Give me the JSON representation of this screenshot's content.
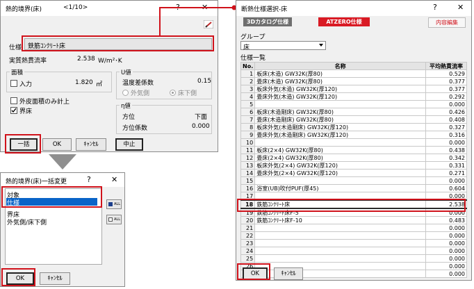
{
  "left_dialog": {
    "title": "熱的境界(床)",
    "counter": "<1/10>",
    "help": "?",
    "close": "✕",
    "spec_label": "仕様",
    "spec_value": "鉄筋ｺﾝｸﾘｰﾄ床",
    "heat_label": "実質熱貫流率",
    "heat_value": "2.538",
    "heat_unit": "W/m²･K",
    "area_group": "面積",
    "input_label": "入力",
    "area_value": "1.820",
    "area_unit": "㎡",
    "outer_area_label": "外皮面積のみ計上",
    "boundary_label": "界床",
    "u_group": "U値",
    "temp_label": "温度差係数",
    "temp_value": "0.15",
    "radio_outside": "外気側",
    "radio_under": "床下側",
    "eta_group": "η値",
    "dir_label": "方位",
    "dir_value": "下面",
    "dir_coef_label": "方位係数",
    "dir_coef_value": "0.000",
    "btn_bulk": "一括",
    "btn_ok": "OK",
    "btn_cancel": "ｷｬﾝｾﾙ",
    "btn_stop": "中止"
  },
  "bulk_dialog": {
    "title": "熱的境界(床)一括変更",
    "help": "?",
    "close": "✕",
    "items": [
      "対象",
      "仕様",
      "界床",
      "外気側/床下側"
    ],
    "selected_index": 1,
    "btn_ok": "OK",
    "btn_cancel": "ｷｬﾝｾﾙ",
    "side_btn1": "ALL",
    "side_btn2": "ALL"
  },
  "right_dialog": {
    "title": "断熱仕様選択-床",
    "help": "?",
    "close": "✕",
    "tab_catalog": "3Dカタログ仕様",
    "tab_atzero": "ATZERO仕様",
    "edit_link": "内容編集",
    "group_label": "グループ",
    "group_value": "床",
    "list_label": "仕様一覧",
    "col_no": "No.",
    "col_name": "名称",
    "col_rate": "平均熱貫流率",
    "rows": [
      {
        "no": "1",
        "name": "板床(木造) GW32K(厚80)",
        "rate": "0.529"
      },
      {
        "no": "2",
        "name": "畳床(木造) GW32K(厚80)",
        "rate": "0.377"
      },
      {
        "no": "3",
        "name": "板床外気(木造) GW32K(厚120)",
        "rate": "0.377"
      },
      {
        "no": "4",
        "name": "畳床外気(木造) GW32K(厚120)",
        "rate": "0.292"
      },
      {
        "no": "5",
        "name": "",
        "rate": "0.000"
      },
      {
        "no": "6",
        "name": "板床(木造剛床) GW32K(厚80)",
        "rate": "0.426"
      },
      {
        "no": "7",
        "name": "畳床(木造剛床) GW32K(厚80)",
        "rate": "0.408"
      },
      {
        "no": "8",
        "name": "板床外気(木造剛床) GW32K(厚120)",
        "rate": "0.327"
      },
      {
        "no": "9",
        "name": "畳床外気(木造剛床) GW32K(厚120)",
        "rate": "0.316"
      },
      {
        "no": "10",
        "name": "",
        "rate": "0.000"
      },
      {
        "no": "11",
        "name": "板床(2×4) GW32K(厚80)",
        "rate": "0.438"
      },
      {
        "no": "12",
        "name": "畳床(2×4) GW32K(厚80)",
        "rate": "0.342"
      },
      {
        "no": "13",
        "name": "板床外気(2×4) GW32K(厚120)",
        "rate": "0.331"
      },
      {
        "no": "14",
        "name": "畳床外気(2×4) GW32K(厚120)",
        "rate": "0.271"
      },
      {
        "no": "15",
        "name": "",
        "rate": "0.000"
      },
      {
        "no": "16",
        "name": "浴室(UB)吹付PUF(厚45)",
        "rate": "0.604"
      },
      {
        "no": "17",
        "name": "",
        "rate": "0.000"
      },
      {
        "no": "18",
        "name": "鉄筋ｺﾝｸﾘｰﾄ床",
        "rate": "2.538"
      },
      {
        "no": "19",
        "name": "鉄筋ｺﾝｸﾘｰﾄ床F-5",
        "rate": "0.000"
      },
      {
        "no": "20",
        "name": "鉄筋ｺﾝｸﾘｰﾄ床F-10",
        "rate": "0.483"
      },
      {
        "no": "21",
        "name": "",
        "rate": "0.000"
      },
      {
        "no": "22",
        "name": "",
        "rate": "0.000"
      },
      {
        "no": "23",
        "name": "",
        "rate": "0.000"
      },
      {
        "no": "24",
        "name": "",
        "rate": "0.000"
      },
      {
        "no": "25",
        "name": "",
        "rate": "0.000"
      },
      {
        "no": "26",
        "name": "",
        "rate": "0.000"
      },
      {
        "no": "27",
        "name": "",
        "rate": "0.000"
      }
    ],
    "selected_no": "18",
    "btn_ok": "OK",
    "btn_cancel": "ｷｬﾝｾﾙ"
  },
  "colors": {
    "highlight_red": "#d0121b",
    "tab_active": "#d91a24",
    "tab_inactive": "#6e6e6e",
    "arrow_gray": "#8f8f8f",
    "selection_blue": "#0a64c8"
  }
}
